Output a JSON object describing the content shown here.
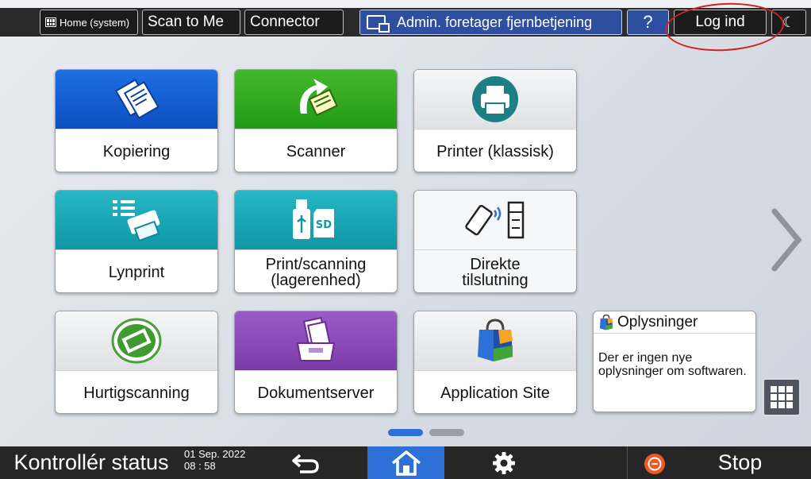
{
  "topbar": {
    "home_label": "Home (system)",
    "scan_to_me": "Scan to Me",
    "connector": "Connector",
    "admin_remote": "Admin. foretager fjernbetjening",
    "help": "?",
    "login": "Log ind"
  },
  "tiles": [
    {
      "label": "Kopiering",
      "icon": "copy-icon"
    },
    {
      "label": "Scanner",
      "icon": "scanner-icon"
    },
    {
      "label": "Printer (klassisk)",
      "icon": "printer-icon"
    },
    {
      "label": "Lynprint",
      "icon": "quick-print-icon"
    },
    {
      "label_line1": "Print/scanning",
      "label_line2": "(lagerenhed)",
      "icon": "usb-sd-icon"
    },
    {
      "label_line1": "Direkte",
      "label_line2": "tilslutning",
      "icon": "direct-connect-icon"
    },
    {
      "label": "Hurtigscanning",
      "icon": "quick-scan-icon"
    },
    {
      "label": "Dokumentserver",
      "icon": "document-server-icon"
    },
    {
      "label": "Application Site",
      "icon": "shopping-bag-icon"
    }
  ],
  "info_widget": {
    "title": "Oplysninger",
    "message": "Der er ingen nye oplysninger om softwaren."
  },
  "pagination": {
    "current": 1,
    "total": 2
  },
  "bottombar": {
    "status": "Kontrollér status",
    "date": "01 Sep. 2022",
    "time": "08 : 58",
    "stop": "Stop"
  },
  "colors": {
    "accent_blue": "#2c70d8",
    "admin_blue": "#2e4fa0",
    "annotation_red": "#d32020"
  }
}
